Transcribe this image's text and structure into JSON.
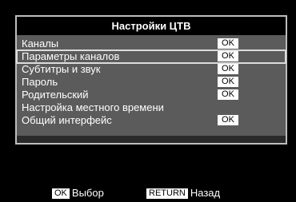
{
  "menu": {
    "title": "Настройки ЦТВ",
    "items": [
      {
        "label": "Каналы",
        "ok": "OK",
        "selected": false
      },
      {
        "label": "Параметры каналов",
        "ok": "OK",
        "selected": true
      },
      {
        "label": "Субтитры и звук",
        "ok": "OK",
        "selected": false
      },
      {
        "label": "Пароль",
        "ok": "OK",
        "selected": false
      },
      {
        "label": "Родительский",
        "ok": "OK",
        "selected": false
      },
      {
        "label": "Настройка местного времени",
        "ok": "",
        "selected": false
      },
      {
        "label": "Общий интерфейс",
        "ok": "OK",
        "selected": false
      }
    ]
  },
  "hints": {
    "ok_key": "OK",
    "ok_text": "Выбор",
    "return_key": "RETURN",
    "return_text": "Назад"
  },
  "colors": {
    "background": "#000000",
    "panel": "#5b5b5b",
    "frame": "#bdbdbd",
    "badge": "#ffffff"
  }
}
